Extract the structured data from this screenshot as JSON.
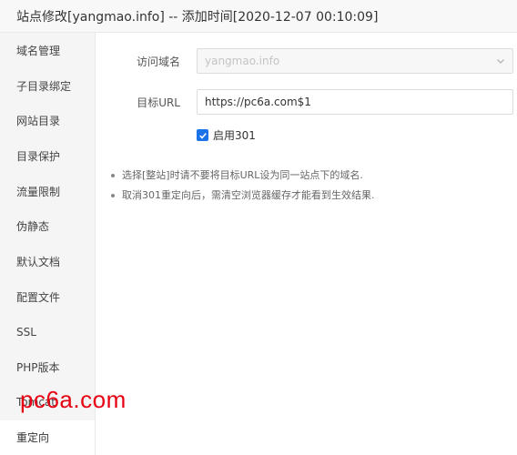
{
  "window": {
    "title": "站点修改[yangmao.info] -- 添加时间[2020-12-07 00:10:09]"
  },
  "sidebar": {
    "items": [
      {
        "label": "域名管理"
      },
      {
        "label": "子目录绑定"
      },
      {
        "label": "网站目录"
      },
      {
        "label": "目录保护"
      },
      {
        "label": "流量限制"
      },
      {
        "label": "伪静态"
      },
      {
        "label": "默认文档"
      },
      {
        "label": "配置文件"
      },
      {
        "label": "SSL"
      },
      {
        "label": "PHP版本"
      },
      {
        "label": "Tomcat"
      },
      {
        "label": "重定向"
      }
    ],
    "active_index": 11
  },
  "form": {
    "domain_label": "访问域名",
    "domain_value": "yangmao.info",
    "target_label": "目标URL",
    "target_value": "https://pc6a.com$1",
    "enable301_label": "启用301",
    "enable301_checked": true
  },
  "notes": [
    "选择[整站]时请不要将目标URL设为同一站点下的域名.",
    "取消301重定向后，需清空浏览器缓存才能看到生效结果."
  ],
  "watermark": "pc6a.com",
  "colors": {
    "accent": "#1a73e8",
    "watermark": "#e60012"
  },
  "icons": {
    "select": "chevron-down-icon",
    "checkbox": "check-icon"
  }
}
